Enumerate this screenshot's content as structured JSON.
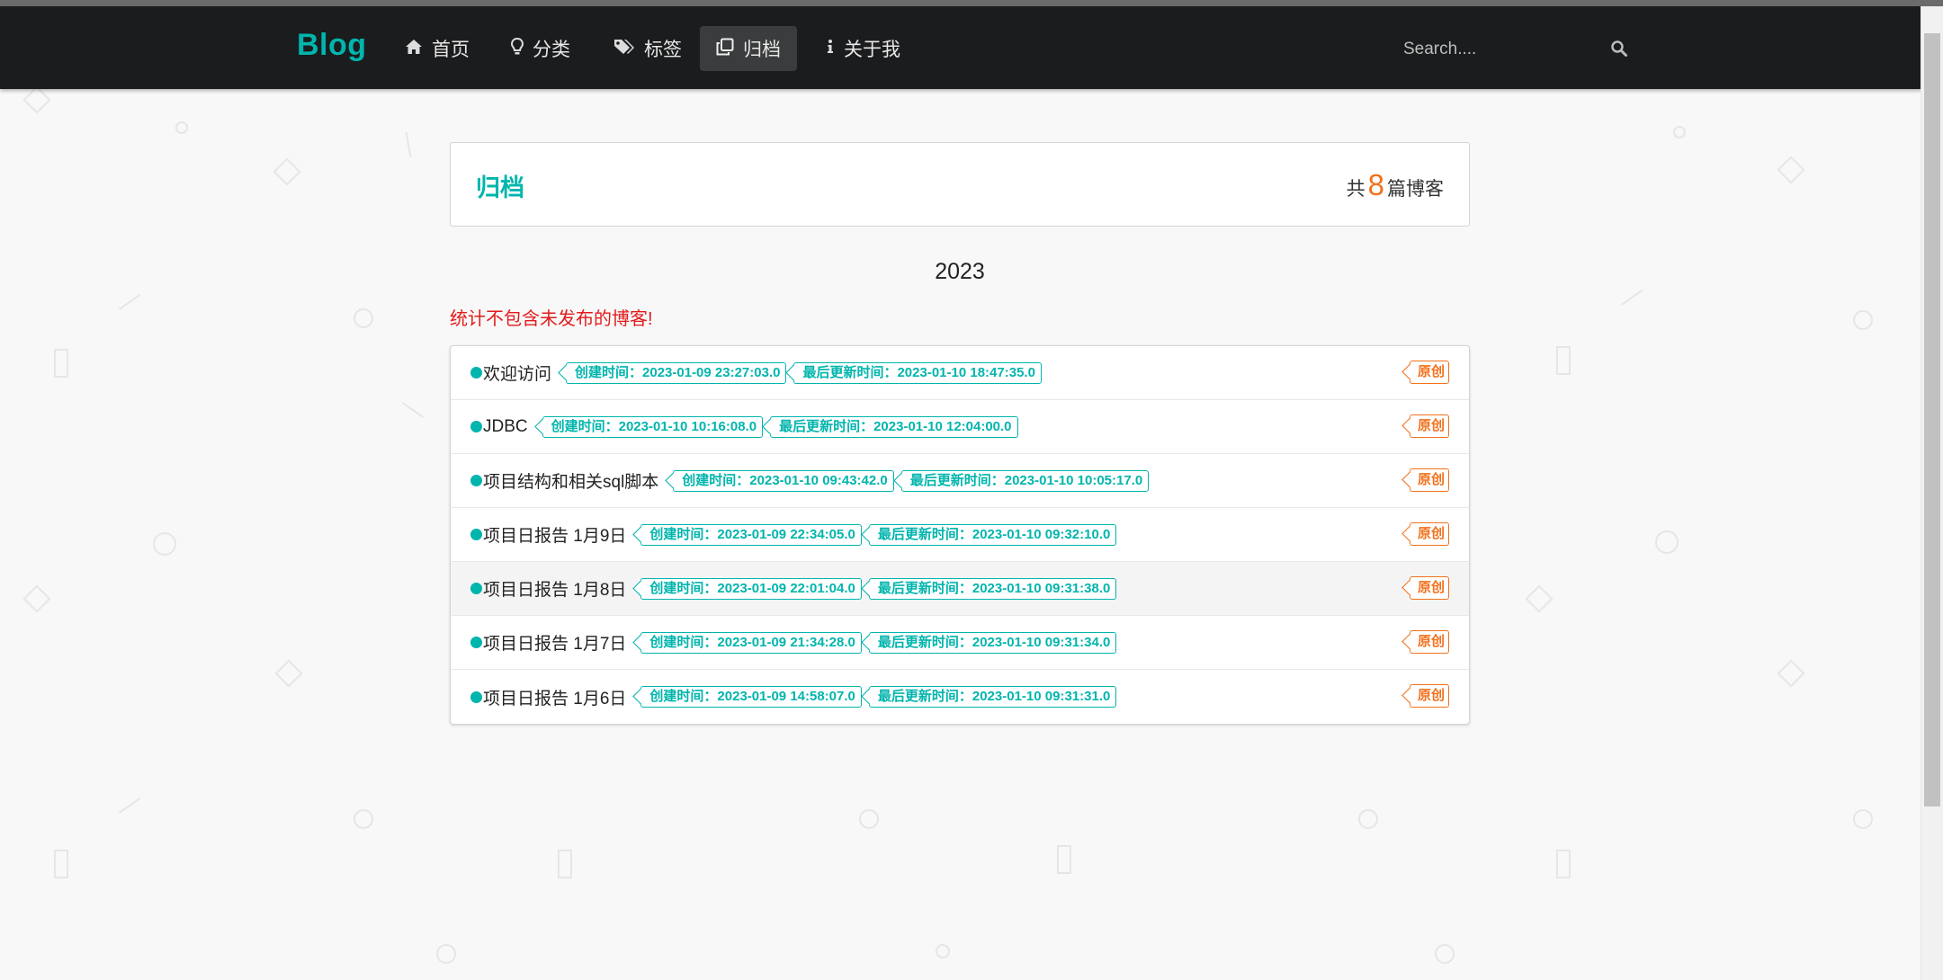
{
  "nav": {
    "brand": "Blog",
    "items": [
      {
        "label": "首页",
        "icon": "home-icon"
      },
      {
        "label": "分类",
        "icon": "lightbulb-icon"
      },
      {
        "label": "标签",
        "icon": "tags-icon"
      },
      {
        "label": "归档",
        "icon": "clone-icon",
        "active": true
      },
      {
        "label": "关于我",
        "icon": "info-icon"
      }
    ],
    "search_placeholder": "Search...."
  },
  "archive": {
    "title": "归档",
    "count_prefix": "共",
    "count": "8",
    "count_suffix": "篇博客",
    "year": "2023",
    "notice": "统计不包含未发布的博客!"
  },
  "posts": [
    {
      "title": "欢迎访问",
      "created": "创建时间：2023-01-09 23:27:03.0",
      "updated": "最后更新时间：2023-01-10 18:47:35.0",
      "label": "原创"
    },
    {
      "title": "JDBC",
      "created": "创建时间：2023-01-10 10:16:08.0",
      "updated": "最后更新时间：2023-01-10 12:04:00.0",
      "label": "原创"
    },
    {
      "title": "项目结构和相关sql脚本",
      "created": "创建时间：2023-01-10 09:43:42.0",
      "updated": "最后更新时间：2023-01-10 10:05:17.0",
      "label": "原创"
    },
    {
      "title": "项目日报告 1月9日",
      "created": "创建时间：2023-01-09 22:34:05.0",
      "updated": "最后更新时间：2023-01-10 09:32:10.0",
      "label": "原创"
    },
    {
      "title": "项目日报告 1月8日",
      "created": "创建时间：2023-01-09 22:01:04.0",
      "updated": "最后更新时间：2023-01-10 09:31:38.0",
      "label": "原创"
    },
    {
      "title": "项目日报告 1月7日",
      "created": "创建时间：2023-01-09 21:34:28.0",
      "updated": "最后更新时间：2023-01-10 09:31:34.0",
      "label": "原创"
    },
    {
      "title": "项目日报告 1月6日",
      "created": "创建时间：2023-01-09 14:58:07.0",
      "updated": "最后更新时间：2023-01-10 09:31:31.0",
      "label": "原创"
    }
  ],
  "colors": {
    "accent": "#00b5ad",
    "orange": "#f2711c",
    "navbar": "#1b1c1d",
    "notice": "#e21b1b"
  }
}
